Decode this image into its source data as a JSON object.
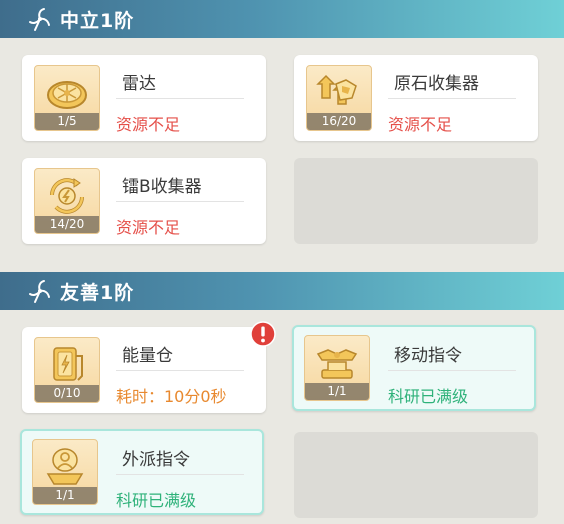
{
  "sections": [
    {
      "title": "中立1阶",
      "items": [
        {
          "name": "雷达",
          "count": "1/5",
          "status": "资源不足"
        },
        {
          "name": "原石收集器",
          "count": "16/20",
          "status": "资源不足"
        },
        {
          "name": "镭B收集器",
          "count": "14/20",
          "status": "资源不足"
        }
      ]
    },
    {
      "title": "友善1阶",
      "items": [
        {
          "name": "能量仓",
          "count": "0/10",
          "status": "耗时：10分0秒",
          "alert": true
        },
        {
          "name": "移动指令",
          "count": "1/1",
          "status": "科研已满级"
        },
        {
          "name": "外派指令",
          "count": "1/1",
          "status": "科研已满级"
        }
      ]
    }
  ],
  "icons": {
    "section": "windmill-icon",
    "radar": "radar-icon",
    "ore_collector": "ore-collector-icon",
    "radium_collector": "radium-collector-icon",
    "energy_storage": "energy-storage-icon",
    "move_command": "move-command-icon",
    "dispatch_command": "dispatch-command-icon",
    "alert": "exclamation-icon"
  },
  "colors": {
    "header_start": "#3f6d8c",
    "header_end": "#6fd0d6",
    "insufficient": "#e5504a",
    "time": "#e8892f",
    "maxed": "#2fb27a",
    "maxed_border": "#a9e6dc",
    "alert": "#e0403a"
  }
}
